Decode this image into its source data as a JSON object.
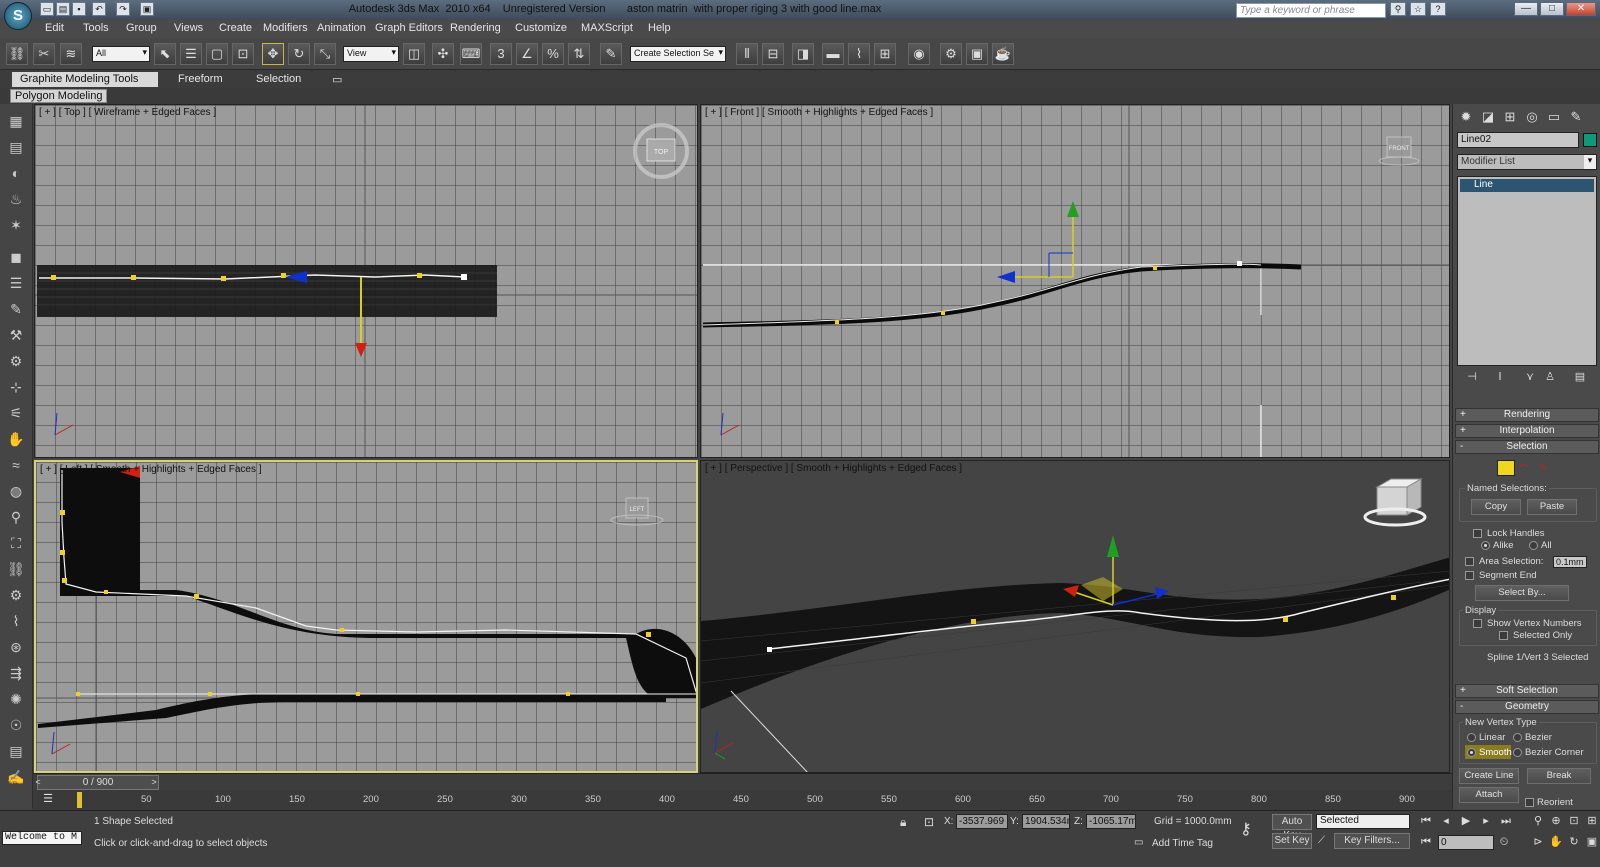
{
  "window": {
    "title": "Autodesk 3ds Max  2010 x64    Unregistered Version       aston matrin  with proper riging 3 with good line.max",
    "search_placeholder": "Type a keyword or phrase",
    "minimize": "—",
    "maximize": "□",
    "close": "✕"
  },
  "menu": [
    "Edit",
    "Tools",
    "Group",
    "Views",
    "Create",
    "Modifiers",
    "Animation",
    "Graph Editors",
    "Rendering",
    "Customize",
    "MAXScript",
    "Help"
  ],
  "toolbar": {
    "selection_filter": "All",
    "ref_coord": "View",
    "named_selection": "Create Selection Se"
  },
  "ribbon": {
    "tabs": [
      "Graphite Modeling Tools",
      "Freeform",
      "Selection"
    ],
    "sub": "Polygon Modeling"
  },
  "viewports": {
    "top": "[ + ] [ Top ] [ Wireframe + Edged Faces ]",
    "front": "[ + ] [ Front ] [ Smooth + Highlights + Edged Faces ]",
    "left": "[ + ] [ Left ] [ Smooth + Highlights + Edged Faces ]",
    "perspective": "[ + ] [ Perspective ] [ Smooth + Highlights + Edged Faces ]",
    "cube_top": "TOP",
    "cube_front": "FRONT",
    "cube_left": "LEFT"
  },
  "command_panel": {
    "object_name": "Line02",
    "object_color": "#0e9a7a",
    "modifier_list": "Modifier List",
    "stack_item": "Line",
    "rollouts": {
      "rendering": "Rendering",
      "interpolation": "Interpolation",
      "selection": "Selection",
      "soft_selection": "Soft Selection",
      "geometry": "Geometry"
    },
    "selection": {
      "named_selections": "Named Selections:",
      "copy": "Copy",
      "paste": "Paste",
      "lock_handles": "Lock Handles",
      "alike": "Alike",
      "all": "All",
      "area_selection": "Area Selection:",
      "area_value": "0.1mm",
      "segment_end": "Segment End",
      "select_by": "Select By...",
      "display": "Display",
      "show_vertex_numbers": "Show Vertex Numbers",
      "selected_only": "Selected Only",
      "status": "Spline 1/Vert 3 Selected"
    },
    "geometry": {
      "new_vertex_type": "New Vertex Type",
      "linear": "Linear",
      "bezier": "Bezier",
      "smooth": "Smooth",
      "bezier_corner": "Bezier Corner",
      "create_line": "Create Line",
      "break": "Break",
      "attach": "Attach",
      "reorient": "Reorient"
    }
  },
  "timeline": {
    "frame": "0 / 900",
    "ticks": [
      "50",
      "100",
      "150",
      "200",
      "250",
      "300",
      "350",
      "400",
      "450",
      "500",
      "550",
      "600",
      "650",
      "700",
      "750",
      "800",
      "850",
      "900"
    ]
  },
  "status": {
    "listener": "Welcome to M",
    "shape_selected": "1 Shape Selected",
    "prompt": "Click or click-and-drag to select objects",
    "x_label": "X:",
    "x": "-3537.969",
    "y_label": "Y:",
    "y": "1904.534m",
    "z_label": "Z:",
    "z": "-1065.17m",
    "grid": "Grid = 1000.0mm",
    "add_time_tag": "Add Time Tag",
    "auto_key": "Auto Key",
    "set_key": "Set Key",
    "selected": "Selected",
    "key_filters": "Key Filters...",
    "current_frame": "0"
  }
}
